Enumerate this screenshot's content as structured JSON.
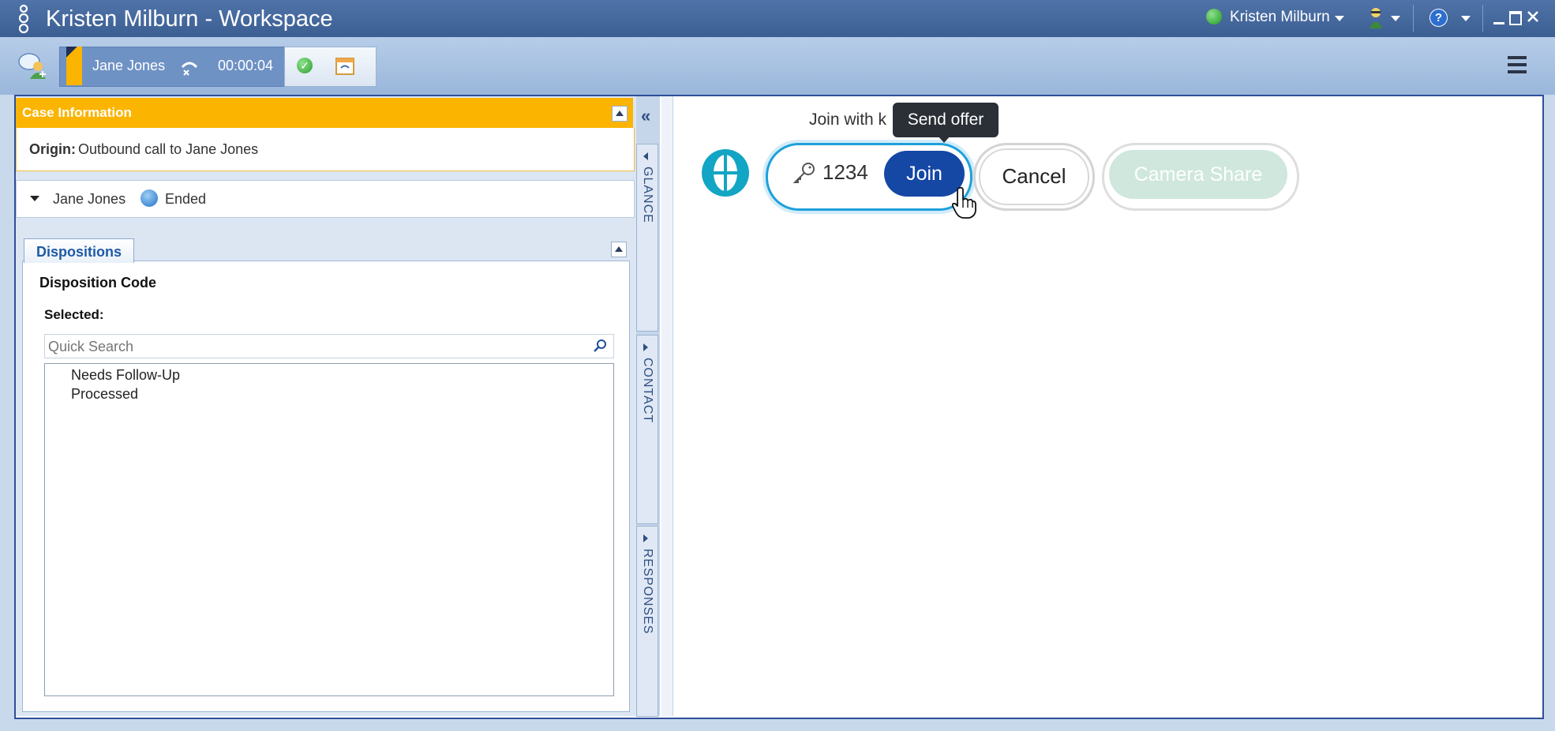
{
  "window": {
    "title": "Kristen Milburn - Workspace",
    "user_name": "Kristen Milburn",
    "status_color": "#2fb52f"
  },
  "toolbar": {
    "contact_name": "Jane Jones",
    "timer": "00:00:04"
  },
  "case_info": {
    "header": "Case Information",
    "origin_label": "Origin:",
    "origin_value": "Outbound call to Jane Jones"
  },
  "party": {
    "name": "Jane Jones",
    "status": "Ended"
  },
  "dispositions": {
    "tab_label": "Dispositions",
    "code_heading": "Disposition Code",
    "selected_label": "Selected:",
    "search_placeholder": "Quick Search",
    "codes": [
      "Needs Follow-Up",
      "Processed"
    ]
  },
  "side_tabs": {
    "glance": "GLANCE",
    "contact": "CONTACT",
    "responses": "RESPONSES"
  },
  "glance_panel": {
    "join_with_text": "Join with k",
    "tooltip": "Send offer",
    "key_code": "1234",
    "join_label": "Join",
    "cancel_label": "Cancel",
    "camera_share_label": "Camera Share"
  },
  "colors": {
    "case_header": "#fbb400",
    "join_button": "#1547a5",
    "key_border": "#1ea0db",
    "glance_teal": "#13a5c4"
  }
}
